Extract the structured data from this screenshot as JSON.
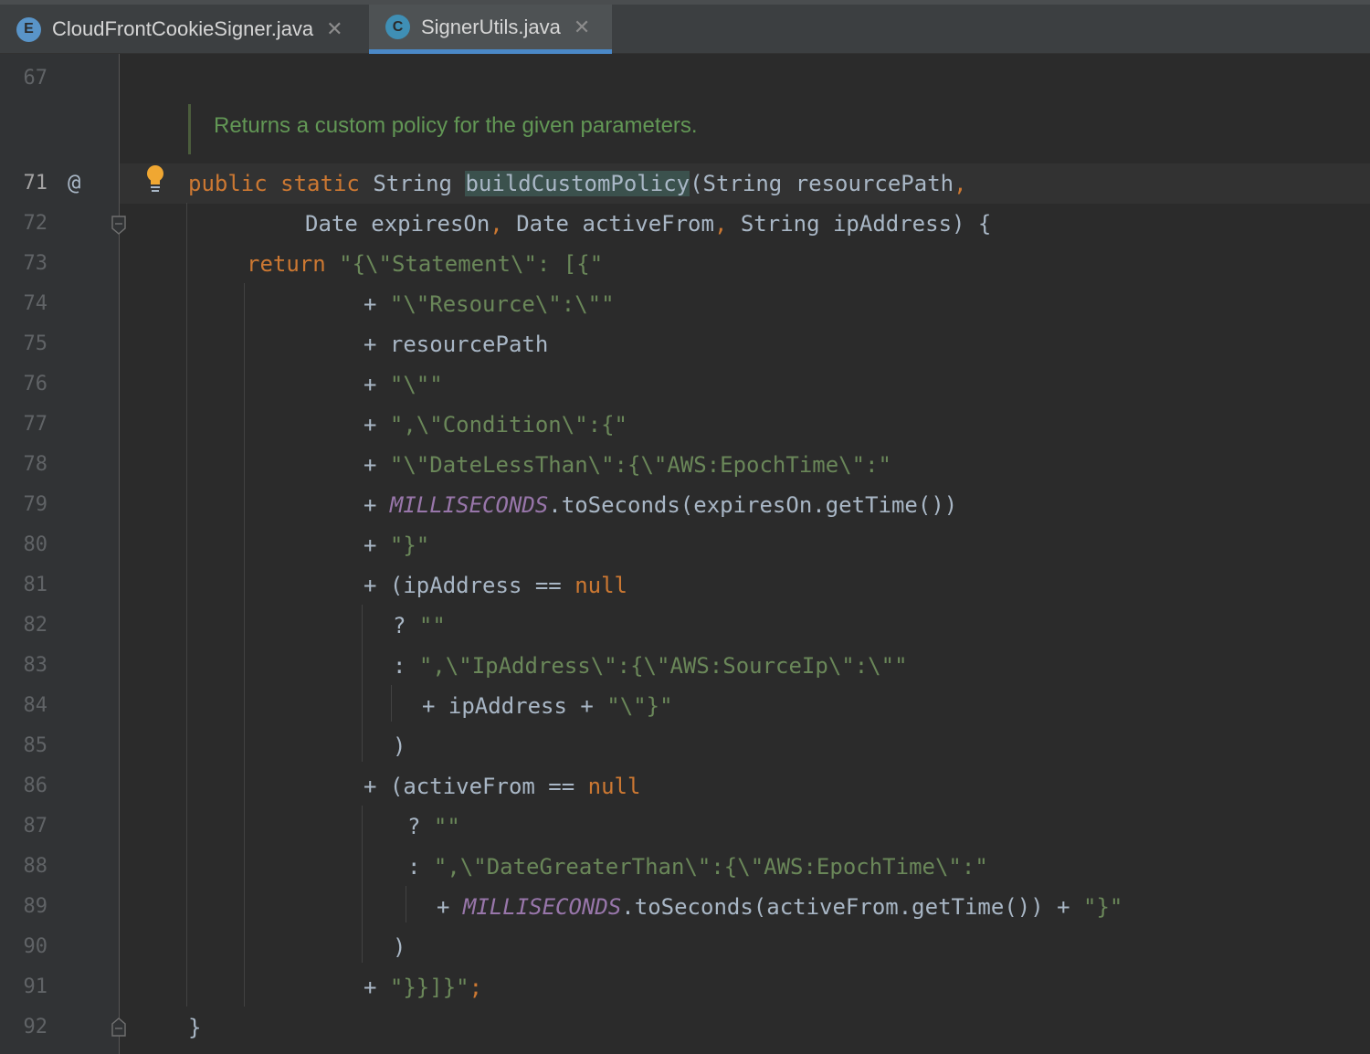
{
  "tabs": [
    {
      "label": "CloudFrontCookieSigner.java",
      "icon": "E",
      "icon_color": "#5994c8",
      "active": false,
      "close": "✕"
    },
    {
      "label": "SignerUtils.java",
      "icon": "C",
      "icon_color": "#3f8fb5",
      "active": true,
      "close": "✕"
    }
  ],
  "gutter": {
    "line_numbers": [
      "67",
      "71",
      "72",
      "73",
      "74",
      "75",
      "76",
      "77",
      "78",
      "79",
      "80",
      "81",
      "82",
      "83",
      "84",
      "85",
      "86",
      "87",
      "88",
      "89",
      "90",
      "91",
      "92"
    ],
    "annotation_marker": "@"
  },
  "doc_comment": "Returns a custom policy for the given parameters.",
  "colors": {
    "keyword": "#cc7832",
    "string": "#6a8759",
    "constant": "#9876aa",
    "text": "#a9b7c6",
    "doc": "#629755"
  },
  "code": {
    "l71": {
      "kw1": "public",
      "kw2": "static",
      "t1": "String",
      "method": "buildCustomPolicy",
      "rest1": "(String resourcePath",
      "comma": ","
    },
    "l72": {
      "a": "Date expiresOn",
      "c1": ",",
      "b": " Date activeFrom",
      "c2": ",",
      "d": " String ipAddress) {"
    },
    "l73": {
      "kw": "return",
      "s": "\"{\\\"Statement\\\": [{\""
    },
    "l74": {
      "op": "+",
      "s": "\"\\\"Resource\\\":\\\"\""
    },
    "l75": {
      "op": "+",
      "t": "resourcePath"
    },
    "l76": {
      "op": "+",
      "s": "\"\\\"\""
    },
    "l77": {
      "op": "+",
      "s": "\",\\\"Condition\\\":{\""
    },
    "l78": {
      "op": "+",
      "s": "\"\\\"DateLessThan\\\":{\\\"AWS:EpochTime\\\":\""
    },
    "l79": {
      "op": "+",
      "c": "MILLISECONDS",
      "t": ".toSeconds(expiresOn.getTime())"
    },
    "l80": {
      "op": "+",
      "s": "\"}\""
    },
    "l81": {
      "op": "+",
      "t": "(ipAddress == ",
      "kw": "null"
    },
    "l82": {
      "op": "?",
      "s": "\"\""
    },
    "l83": {
      "op": ":",
      "s": "\",\\\"IpAddress\\\":{\\\"AWS:SourceIp\\\":\\\"\""
    },
    "l84": {
      "op": "+",
      "t": "ipAddress + ",
      "s": "\"\\\"}\""
    },
    "l85": {
      "t": ")"
    },
    "l86": {
      "op": "+",
      "t": "(activeFrom == ",
      "kw": "null"
    },
    "l87": {
      "op": "?",
      "s": "\"\""
    },
    "l88": {
      "op": ":",
      "s": "\",\\\"DateGreaterThan\\\":{\\\"AWS:EpochTime\\\":\""
    },
    "l89": {
      "op": "+",
      "c": "MILLISECONDS",
      "t": ".toSeconds(activeFrom.getTime()) + ",
      "s": "\"}\""
    },
    "l90": {
      "t": ")"
    },
    "l91": {
      "op": "+",
      "s": "\"}}]}\"",
      "semi": ";"
    },
    "l92": {
      "t": "}"
    }
  }
}
